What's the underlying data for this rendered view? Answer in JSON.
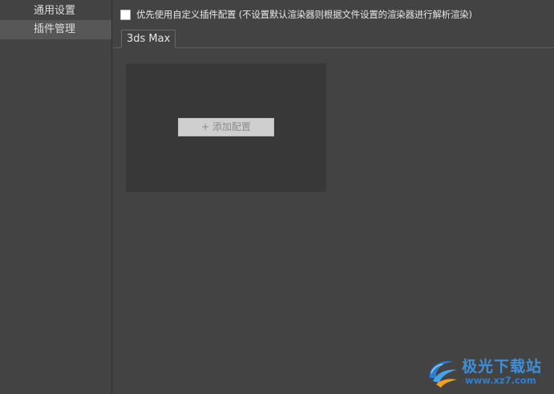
{
  "sidebar": {
    "items": [
      {
        "label": "通用设置",
        "active": false
      },
      {
        "label": "插件管理",
        "active": true
      }
    ]
  },
  "preference": {
    "checked": false,
    "label": "优先使用自定义插件配置 (不设置默认渲染器则根据文件设置的渲染器进行解析渲染)"
  },
  "tabs": [
    {
      "label": "3ds Max",
      "active": true
    }
  ],
  "config": {
    "add_button_label": "+ 添加配置"
  },
  "watermark": {
    "title": "极光下载站",
    "url": "www.xz7.com",
    "icon": "aurora-logo-icon"
  },
  "colors": {
    "background": "#434343",
    "sidebar_active": "#575757",
    "panel": "#383838",
    "button": "#cfcfcf",
    "watermark_blue": "#3f8fd8"
  }
}
